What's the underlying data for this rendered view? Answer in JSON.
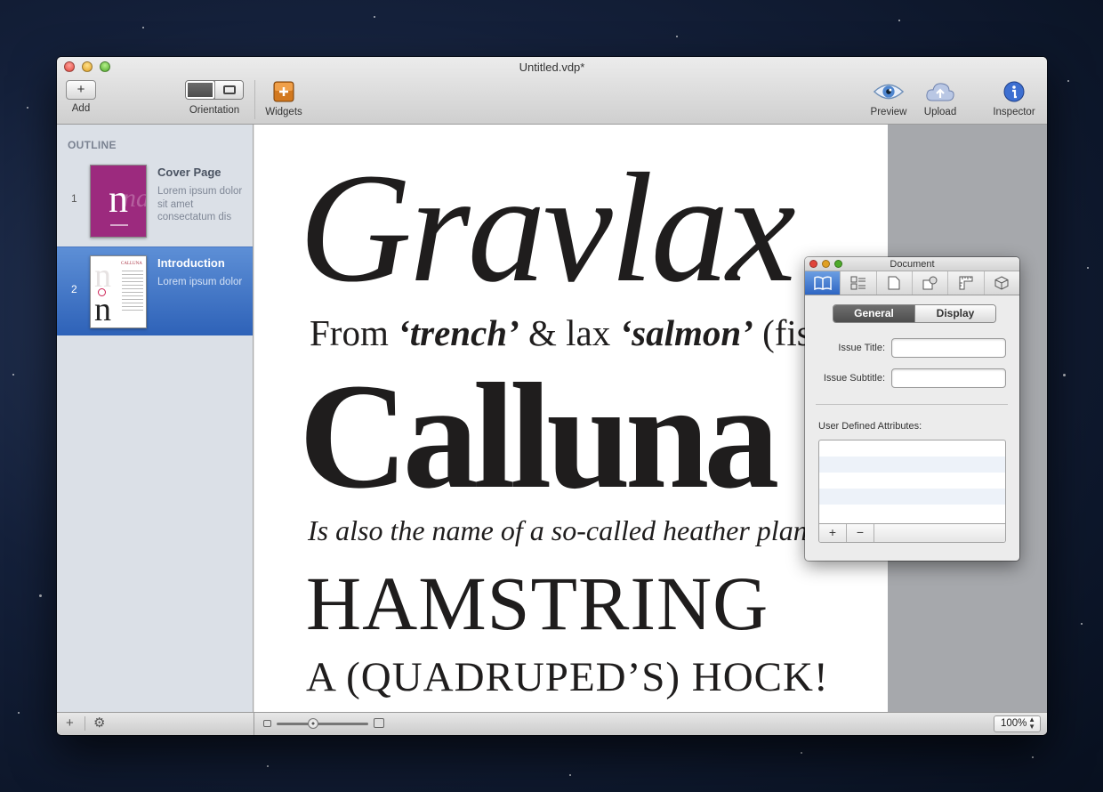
{
  "window": {
    "title": "Untitled.vdp*"
  },
  "toolbar": {
    "add": "Add",
    "add_glyph": "+",
    "orientation": "Orientation",
    "widgets": "Widgets",
    "preview": "Preview",
    "upload": "Upload",
    "inspector": "Inspector"
  },
  "sidebar": {
    "header": "OUTLINE",
    "items": [
      {
        "num": "1",
        "title": "Cover Page",
        "desc": "Lorem ipsum dolor sit amet consectatum dis",
        "thumb_glyph": "n",
        "thumb_ghost": "na"
      },
      {
        "num": "2",
        "title": "Introduction",
        "desc": "Lorem ipsum dolor",
        "thumb_glyph": "n",
        "thumb_head": "CALLUNA"
      }
    ]
  },
  "page": {
    "line1": "Gravlax",
    "line2a": "From ",
    "line2b": "‘trench’",
    "line2c": " & lax ",
    "line2d": "‘salmon’",
    "line2e": " (fish",
    "line3": "Calluna",
    "line4": "Is also the name of a so-called heather plant",
    "line5": "HAMSTRING",
    "line6": "A (QUADRUPED’S) HOCK!"
  },
  "bottombar": {
    "add_glyph": "+",
    "gear_glyph": "⚙",
    "zoom": "100%"
  },
  "inspector": {
    "title": "Document",
    "tabs": [
      "General",
      "Display"
    ],
    "issue_title_label": "Issue Title:",
    "issue_subtitle_label": "Issue Subtitle:",
    "issue_title_value": "",
    "issue_subtitle_value": "",
    "attributes_label": "User Defined Attributes:",
    "add_glyph": "+",
    "remove_glyph": "−"
  },
  "colors": {
    "selection": "#3a6dc0",
    "cover_magenta": "#9c2a7e",
    "sidebar_bg": "#dbe0e7"
  },
  "icons": [
    "plus-icon",
    "portrait-icon",
    "landscape-icon",
    "widgets-icon",
    "eye-icon",
    "cloud-upload-icon",
    "info-icon",
    "gear-icon",
    "book-icon",
    "list-icon",
    "page-icon",
    "shapes-icon",
    "ruler-icon",
    "cube-icon"
  ]
}
